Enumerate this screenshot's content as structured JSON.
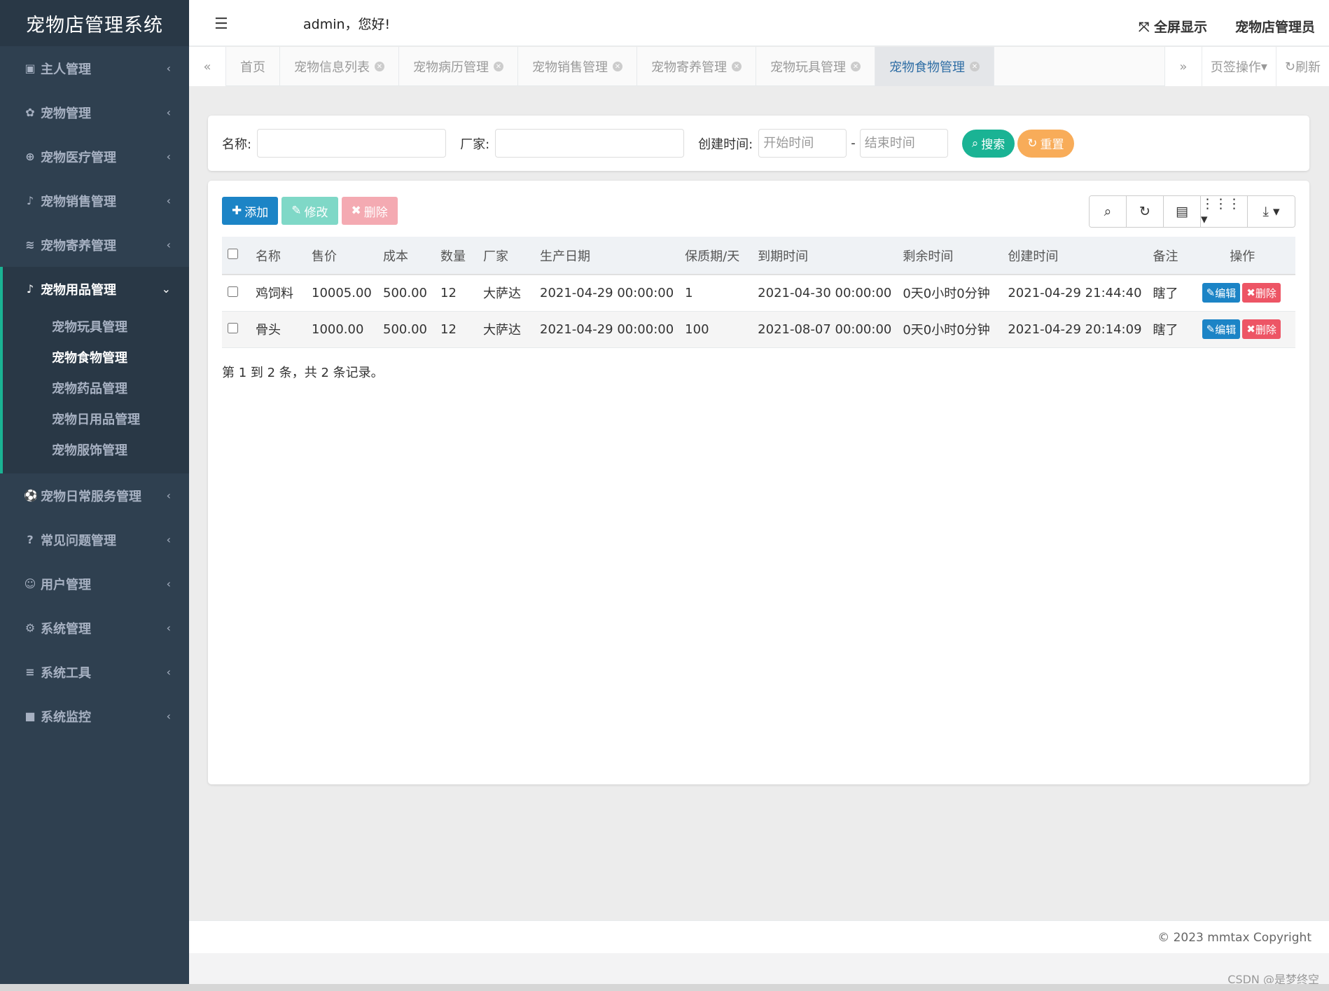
{
  "app": {
    "title": "宠物店管理系统",
    "greeting": "admin，您好!",
    "fullscreen_label": "全屏显示",
    "user_role": "宠物店管理员"
  },
  "sidebar": {
    "items": [
      {
        "label": "主人管理",
        "icon": "address-card-icon",
        "glyph": "▣"
      },
      {
        "label": "宠物管理",
        "icon": "paw-icon",
        "glyph": "✿"
      },
      {
        "label": "宠物医疗管理",
        "icon": "plus-circle-icon",
        "glyph": "⊕"
      },
      {
        "label": "宠物销售管理",
        "icon": "bell-icon",
        "glyph": "♪"
      },
      {
        "label": "宠物寄养管理",
        "icon": "wifi-icon",
        "glyph": "≋"
      },
      {
        "label": "宠物用品管理",
        "icon": "bell-icon",
        "glyph": "♪"
      },
      {
        "label": "宠物日常服务管理",
        "icon": "soccer-ball-icon",
        "glyph": "⚽"
      },
      {
        "label": "常见问题管理",
        "icon": "question-circle-icon",
        "glyph": "?"
      },
      {
        "label": "用户管理",
        "icon": "user-circle-icon",
        "glyph": "☺"
      },
      {
        "label": "系统管理",
        "icon": "gear-icon",
        "glyph": "⚙"
      },
      {
        "label": "系统工具",
        "icon": "bars-icon",
        "glyph": "≡"
      },
      {
        "label": "系统监控",
        "icon": "video-camera-icon",
        "glyph": "■"
      }
    ],
    "active_submenu": [
      {
        "label": "宠物玩具管理"
      },
      {
        "label": "宠物食物管理"
      },
      {
        "label": "宠物药品管理"
      },
      {
        "label": "宠物日用品管理"
      },
      {
        "label": "宠物服饰管理"
      }
    ]
  },
  "tabs": {
    "items": [
      {
        "label": "首页"
      },
      {
        "label": "宠物信息列表"
      },
      {
        "label": "宠物病历管理"
      },
      {
        "label": "宠物销售管理"
      },
      {
        "label": "宠物寄养管理"
      },
      {
        "label": "宠物玩具管理"
      },
      {
        "label": "宠物食物管理"
      }
    ],
    "page_ops_label": "页签操作",
    "refresh_label": "刷新"
  },
  "search": {
    "name_label": "名称:",
    "maker_label": "厂家:",
    "created_label": "创建时间:",
    "start_placeholder": "开始时间",
    "end_placeholder": "结束时间",
    "dash": "-",
    "search_button": "搜索",
    "reset_button": "重置"
  },
  "toolbar": {
    "add_label": "添加",
    "edit_label": "修改",
    "delete_label": "删除"
  },
  "table": {
    "columns": [
      "名称",
      "售价",
      "成本",
      "数量",
      "厂家",
      "生产日期",
      "保质期/天",
      "到期时间",
      "剩余时间",
      "创建时间",
      "备注",
      "操作"
    ],
    "rows": [
      [
        "鸡饲料",
        "10005.00",
        "500.00",
        "12",
        "大萨达",
        "2021-04-29 00:00:00",
        "1",
        "2021-04-30 00:00:00",
        "0天0小时0分钟",
        "2021-04-29 21:44:40",
        "瞎了"
      ],
      [
        "骨头",
        "1000.00",
        "500.00",
        "12",
        "大萨达",
        "2021-04-29 00:00:00",
        "100",
        "2021-08-07 00:00:00",
        "0天0小时0分钟",
        "2021-04-29 20:14:09",
        "瞎了"
      ]
    ],
    "row_edit_label": "编辑",
    "row_delete_label": "删除",
    "pagination_info": "第 1 到 2 条，共 2 条记录。"
  },
  "footer": {
    "copyright": "© 2023 mmtax Copyright",
    "watermark": "CSDN @是梦终空"
  },
  "colors": {
    "sidebar_bg": "#2f4050",
    "accent_green": "#1ab394",
    "primary_blue": "#1c84c6",
    "danger_red": "#ed5565",
    "warning_orange": "#f8ac59"
  }
}
